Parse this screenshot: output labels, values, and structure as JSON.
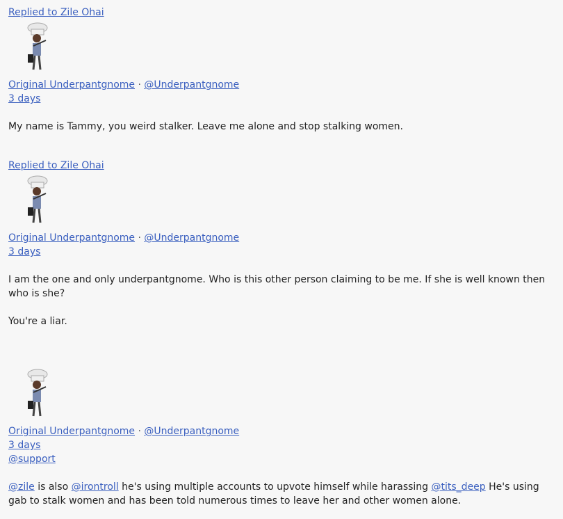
{
  "posts": [
    {
      "replied_to": "Replied to Zile Ohai",
      "display_name": "Original Underpantgnome",
      "separator": "·",
      "username": "@Underpantgnome",
      "time": "3 days",
      "text": "My name is Tammy, you weird stalker. Leave me alone and stop stalking women."
    },
    {
      "replied_to": "Replied to Zile Ohai",
      "display_name": "Original Underpantgnome",
      "separator": "·",
      "username": "@Underpantgnome",
      "time": "3 days",
      "text": "I am the one and only underpantgnome. Who is this other person claiming to be me. If she is well known then who is she?",
      "text2": "You're a liar."
    },
    {
      "display_name": "Original Underpantgnome",
      "separator": "·",
      "username": "@Underpantgnome",
      "time": "3 days",
      "mention_line": "@support",
      "m1": "@zile",
      "t1": " is also ",
      "m2": "@irontroll",
      "t2": " he's using multiple accounts to upvote himself while harassing ",
      "m3": "@tits_deep",
      "t3": " He's using gab to stalk women and has been told numerous times to leave her and other women alone."
    }
  ]
}
